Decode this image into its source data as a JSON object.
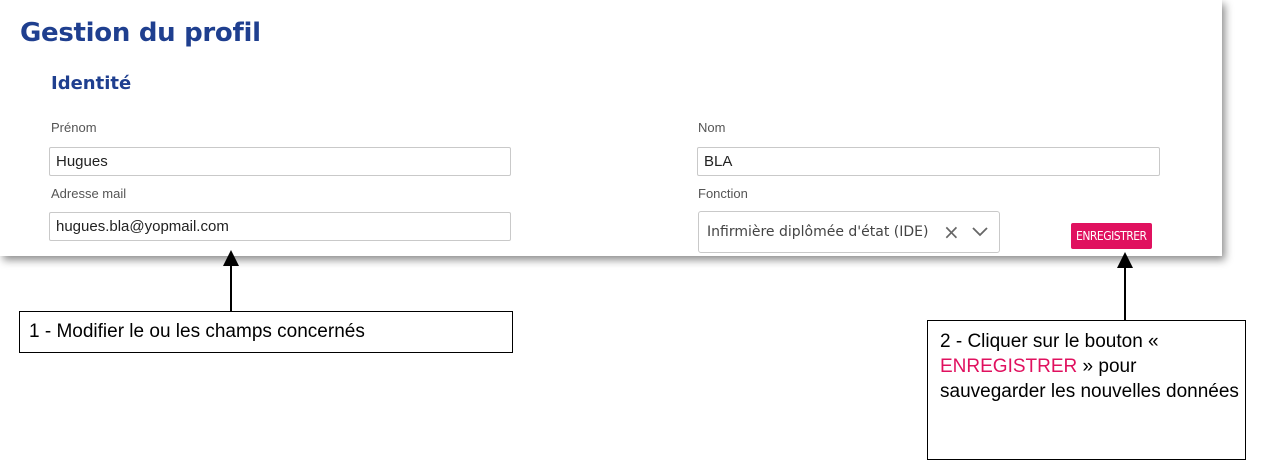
{
  "page": {
    "title": "Gestion du profil"
  },
  "identity": {
    "section_title": "Identité",
    "first_name": {
      "label": "Prénom",
      "value": "Hugues"
    },
    "last_name": {
      "label": "Nom",
      "value": "BLA"
    },
    "email": {
      "label": "Adresse mail",
      "value": "hugues.bla@yopmail.com"
    },
    "function": {
      "label": "Fonction",
      "value": "Infirmière diplômée d'état (IDE)"
    },
    "save_label": "ENREGISTRER"
  },
  "annotations": {
    "step1": "1 - Modifier le ou les champs concernés",
    "step2_prefix": "2 - Cliquer sur le bouton «",
    "step2_button": "ENREGISTRER",
    "step2_suffix": "» pour sauvegarder les nouvelles données"
  },
  "colors": {
    "title_blue": "#1f3f8f",
    "accent_pink": "#e0115f"
  },
  "icons": {
    "clear": "close-icon",
    "dropdown": "chevron-down-icon",
    "arrow": "arrow-up-icon"
  }
}
